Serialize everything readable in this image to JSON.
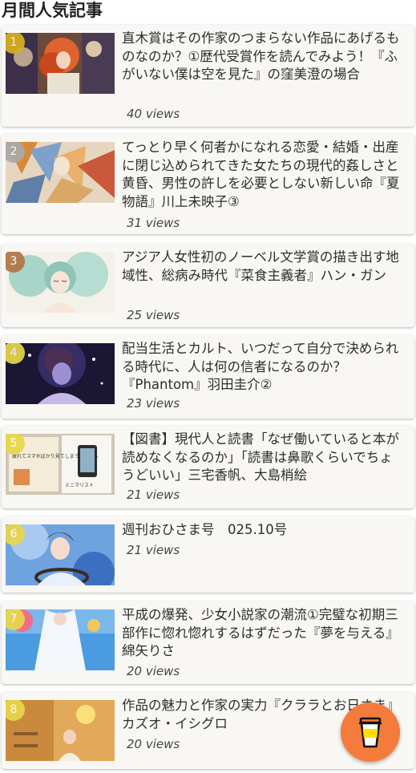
{
  "section": {
    "title": "月間人気記事"
  },
  "colors": {
    "rank_gold": "#d9b21e",
    "rank_silver": "#a9a9a9",
    "rank_bronze": "#b07544",
    "rank_default": "#e8d84a",
    "fab": "#f47b3c",
    "card_bg": "#f8f7f3"
  },
  "articles": [
    {
      "rank": "1",
      "title": "直木賞はその作家のつまらない作品にあげるものなのか？①歴代受賞作を読んでみよう！『ふがいない僕は空を見た』の窪美澄の場合",
      "views": "40 views"
    },
    {
      "rank": "2",
      "title": "てっとり早く何者かになれる恋愛・結婚・出産に閉じ込められてきた女たちの現代的姦しさと黄昏、男性の許しを必要としない新しい命『夏物語』川上未映子③",
      "views": "31 views"
    },
    {
      "rank": "3",
      "title": "アジア人女性初のノーベル文学賞の描き出す地域性、総病み時代『菜食主義者』ハン・ガン",
      "views": "25 views"
    },
    {
      "rank": "4",
      "title": "配当生活とカルト、いつだって自分で決められる時代に、人は何の信者になるのか？『Phantom』羽田圭介②",
      "views": "23 views"
    },
    {
      "rank": "5",
      "title": "【図書】現代人と読書「なぜ働いていると本が読めなくなるのか」「読書は鼻歌くらいでちょうどいい」三宅香帆、大島梢絵",
      "views": "21 views",
      "thumb_text": {
        "cover_a": "疲れてスマホばかり見てしまうあなたへ",
        "cover_b": "ミニマリスト"
      }
    },
    {
      "rank": "6",
      "title": "週刊おひさま号　025.10号",
      "views": "21 views"
    },
    {
      "rank": "7",
      "title": "平成の爆発、少女小説家の潮流①完璧な初期三部作に惚れ惚れするはずだった『夢を与える』綿矢りさ",
      "views": "20 views"
    },
    {
      "rank": "8",
      "title": "作品の魅力と作家の実力『クララとお日さま』カズオ・イシグロ",
      "views": "20 views"
    }
  ],
  "fab": {
    "icon": "coffee-cup-icon"
  }
}
